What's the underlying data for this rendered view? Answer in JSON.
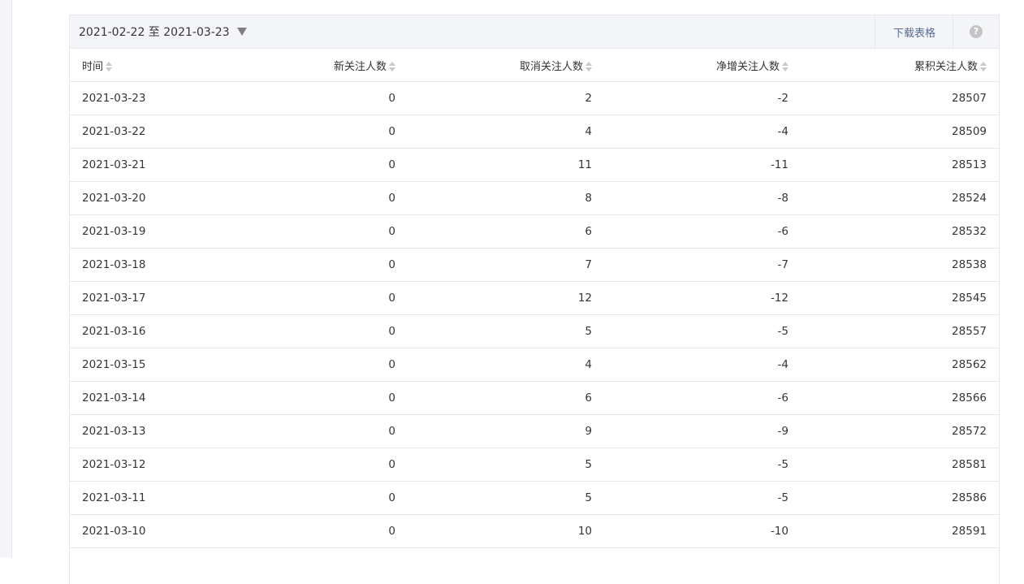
{
  "toolbar": {
    "date_range": "2021-02-22 至 2021-03-23",
    "download_label": "下载表格",
    "help_glyph": "?"
  },
  "table": {
    "headers": [
      "时间",
      "新关注人数",
      "取消关注人数",
      "净增关注人数",
      "累积关注人数"
    ],
    "rows": [
      [
        "2021-03-23",
        "0",
        "2",
        "-2",
        "28507"
      ],
      [
        "2021-03-22",
        "0",
        "4",
        "-4",
        "28509"
      ],
      [
        "2021-03-21",
        "0",
        "11",
        "-11",
        "28513"
      ],
      [
        "2021-03-20",
        "0",
        "8",
        "-8",
        "28524"
      ],
      [
        "2021-03-19",
        "0",
        "6",
        "-6",
        "28532"
      ],
      [
        "2021-03-18",
        "0",
        "7",
        "-7",
        "28538"
      ],
      [
        "2021-03-17",
        "0",
        "12",
        "-12",
        "28545"
      ],
      [
        "2021-03-16",
        "0",
        "5",
        "-5",
        "28557"
      ],
      [
        "2021-03-15",
        "0",
        "4",
        "-4",
        "28562"
      ],
      [
        "2021-03-14",
        "0",
        "6",
        "-6",
        "28566"
      ],
      [
        "2021-03-13",
        "0",
        "9",
        "-9",
        "28572"
      ],
      [
        "2021-03-12",
        "0",
        "5",
        "-5",
        "28581"
      ],
      [
        "2021-03-11",
        "0",
        "5",
        "-5",
        "28586"
      ],
      [
        "2021-03-10",
        "0",
        "10",
        "-10",
        "28591"
      ]
    ]
  },
  "colors": {
    "toolbar_bg": "#f4f5f9",
    "border": "#e7e7eb",
    "link": "#576b95",
    "text": "#353535"
  }
}
